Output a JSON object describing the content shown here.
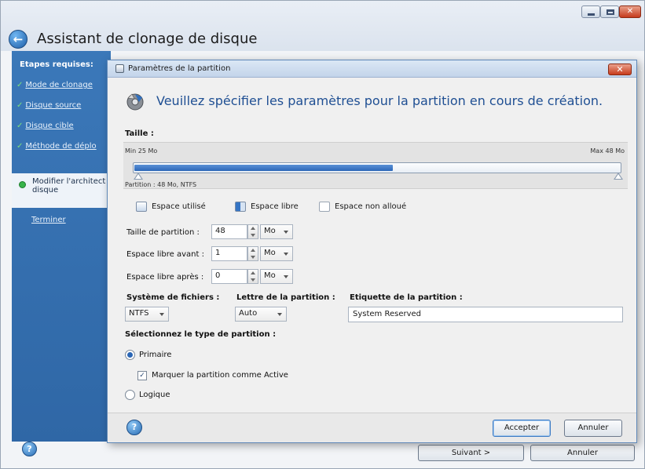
{
  "window": {
    "title": "Assistant de clonage de disque",
    "icon": "back-arrow-icon"
  },
  "sidebar": {
    "heading": "Etapes requises:",
    "items": [
      {
        "label": "Mode de clonage",
        "done": true
      },
      {
        "label": "Disque source",
        "done": true
      },
      {
        "label": "Disque cible",
        "done": true
      },
      {
        "label": "Méthode de déplo",
        "done": true
      }
    ],
    "current": "Modifier l'architect disque",
    "finish": "Terminer"
  },
  "footer": {
    "next_label": "Suivant >",
    "cancel_label": "Annuler"
  },
  "dialog": {
    "title": "Paramètres de la partition",
    "heading": "Veuillez spécifier les paramètres pour la partition en cours de création.",
    "size_label": "Taille :",
    "slider": {
      "min_label": "Min 25 Mo",
      "max_label": "Max 48 Mo",
      "partition_info": "Partition : 48 Mo, NTFS",
      "used_fraction": 0.53
    },
    "legend": {
      "used": "Espace utilisé",
      "free": "Espace libre",
      "unallocated": "Espace non alloué"
    },
    "fields": {
      "partition_size_label": "Taille de partition :",
      "partition_size_value": "48",
      "free_before_label": "Espace libre avant :",
      "free_before_value": "1",
      "free_after_label": "Espace libre après :",
      "free_after_value": "0",
      "unit": "Mo"
    },
    "filesystem_label": "Système de fichiers :",
    "filesystem_value": "NTFS",
    "drive_letter_label": "Lettre de la partition :",
    "drive_letter_value": "Auto",
    "volume_label_label": "Etiquette de la partition :",
    "volume_label_value": "System Reserved",
    "type_label": "Sélectionnez le type de partition :",
    "type_primary": "Primaire",
    "mark_active": "Marquer la partition comme Active",
    "type_logical": "Logique",
    "accept_label": "Accepter",
    "cancel_label": "Annuler"
  }
}
